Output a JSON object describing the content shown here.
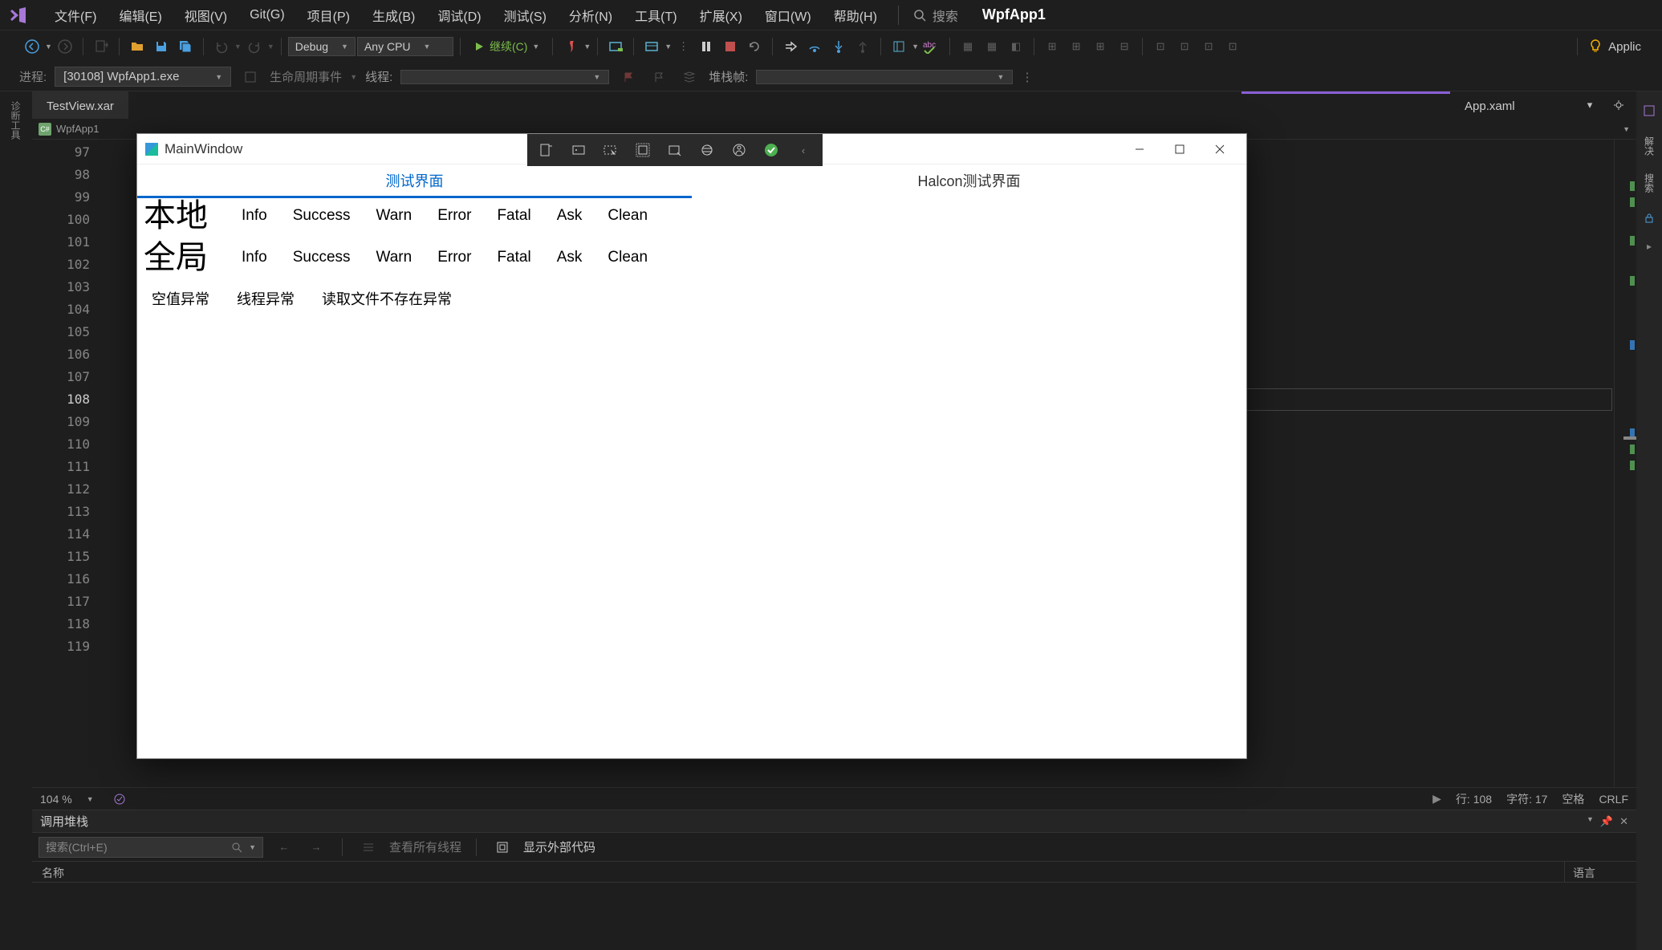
{
  "menubar": {
    "items": [
      "文件(F)",
      "编辑(E)",
      "视图(V)",
      "Git(G)",
      "项目(P)",
      "生成(B)",
      "调试(D)",
      "测试(S)",
      "分析(N)",
      "工具(T)",
      "扩展(X)",
      "窗口(W)",
      "帮助(H)"
    ],
    "search_placeholder": "搜索",
    "app_name": "WpfApp1",
    "applic_label": "Applic"
  },
  "toolbar": {
    "config": "Debug",
    "platform": "Any CPU",
    "continue_label": "继续(C)"
  },
  "process_bar": {
    "proc_label": "进程:",
    "proc_value": "[30108] WpfApp1.exe",
    "lifecycle_label": "生命周期事件",
    "thread_label": "线程:",
    "stackframe_label": "堆栈帧:"
  },
  "tabs": {
    "left": "TestView.xar",
    "right": "App.xaml"
  },
  "breadcrumb": {
    "project": "WpfApp1"
  },
  "editor": {
    "first_line": 97,
    "last_line": 119,
    "current_line": 108,
    "zoom": "104 %"
  },
  "status": {
    "line": "行: 108",
    "chars": "字符: 17",
    "spaces": "空格",
    "crlf": "CRLF"
  },
  "mdi": {
    "title": "MainWindow",
    "tab_active": "测试界面",
    "tab_inactive": "Halcon测试界面",
    "row1_label": "本地",
    "row2_label": "全局",
    "buttons": [
      "Info",
      "Success",
      "Warn",
      "Error",
      "Fatal",
      "Ask",
      "Clean"
    ],
    "exc_buttons": [
      "空值异常",
      "线程异常",
      "读取文件不存在异常"
    ]
  },
  "panel": {
    "title": "调用堆栈",
    "search_placeholder": "搜索(Ctrl+E)",
    "view_all_threads": "查看所有线程",
    "show_external": "显示外部代码",
    "col_name": "名称",
    "col_lang": "语言"
  },
  "right_side": {
    "solution": "解决",
    "search": "搜索"
  },
  "left_side": {
    "label": "诊断工具"
  }
}
